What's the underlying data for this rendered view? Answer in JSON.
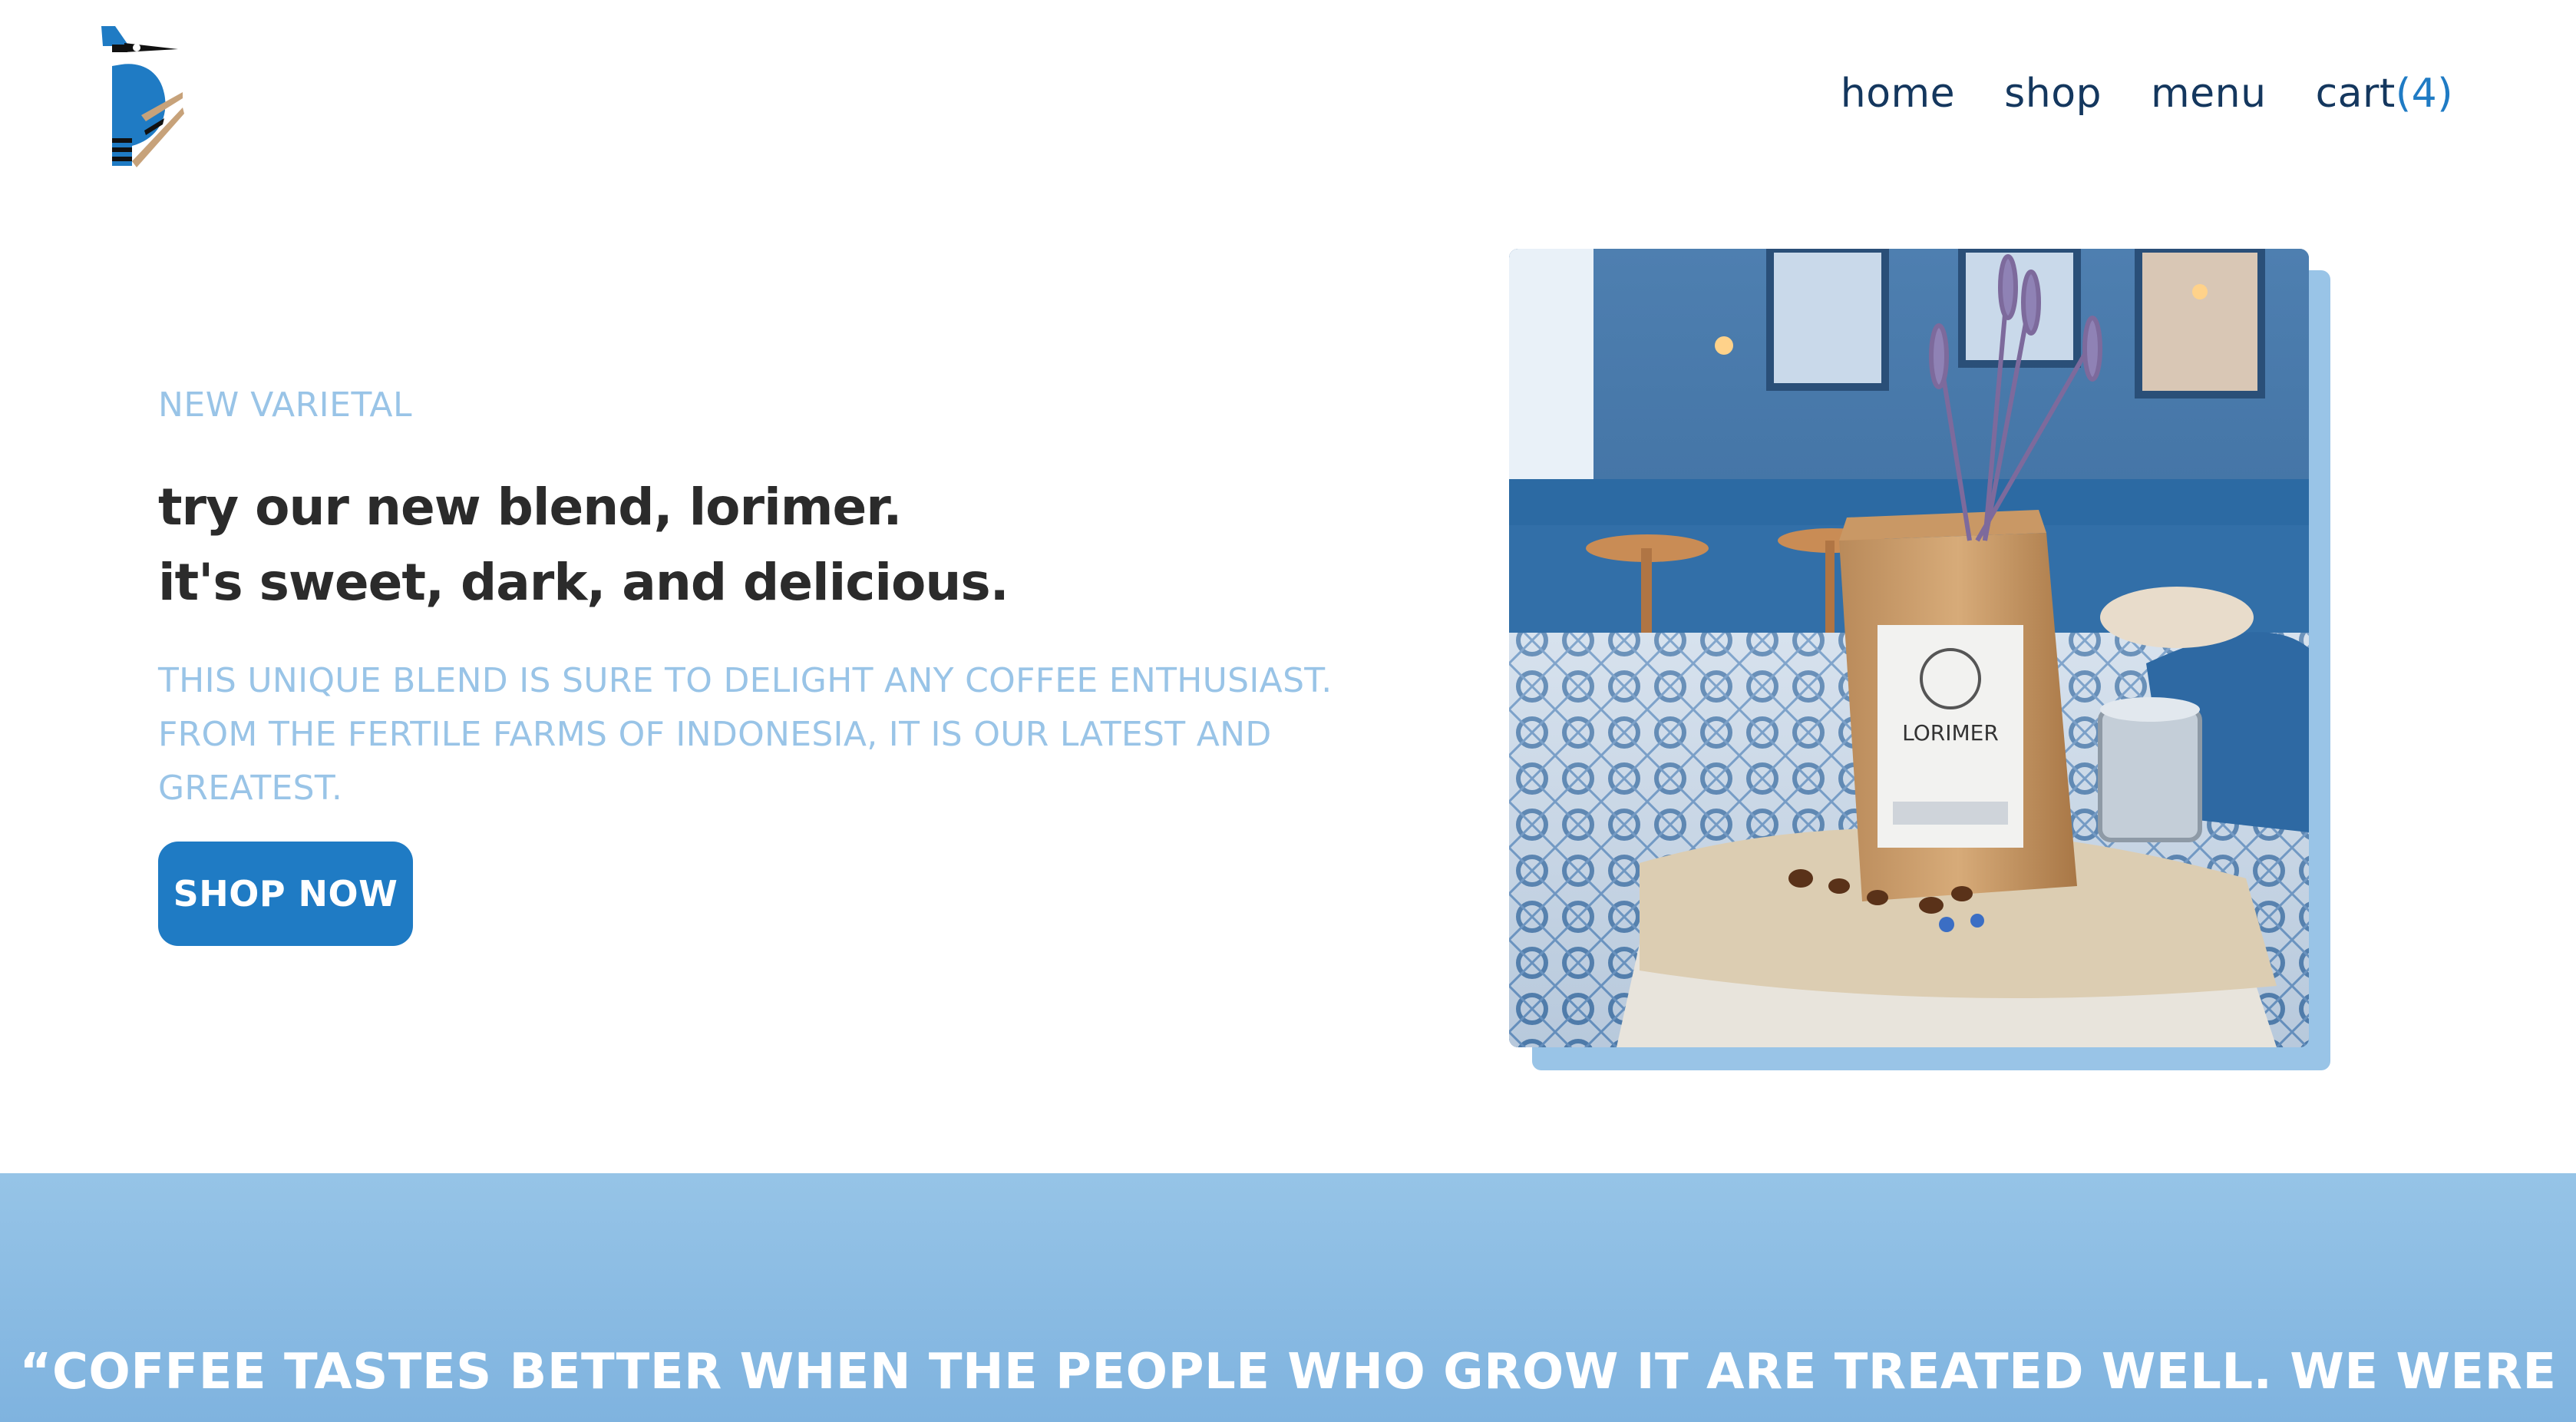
{
  "brand": {
    "logo_icon": "blue-jay-logo-icon"
  },
  "nav": {
    "home": "home",
    "shop": "shop",
    "menu": "menu",
    "cart_label": "cart",
    "cart_count": "(4)"
  },
  "hero": {
    "eyebrow": "NEW VARIETAL",
    "headline_line1": "try our new blend, lorimer.",
    "headline_line2": "it's sweet, dark, and delicious.",
    "description": "THIS UNIQUE BLEND IS SURE TO DELIGHT ANY COFFEE ENTHUSIAST. FROM THE FERTILE FARMS OF INDONESIA, IT IS OUR LATEST AND GREATEST.",
    "cta_label": "SHOP NOW",
    "image_bag_label": "LORIMER"
  },
  "quote": {
    "text": "“COFFEE TASTES BETTER WHEN THE PEOPLE WHO GROW IT ARE TREATED WELL. WE WERE"
  },
  "colors": {
    "accent": "#1f7bc4",
    "light_blue": "#99c4e7",
    "nav_text": "#14375e",
    "heading": "#2b2b2b"
  }
}
